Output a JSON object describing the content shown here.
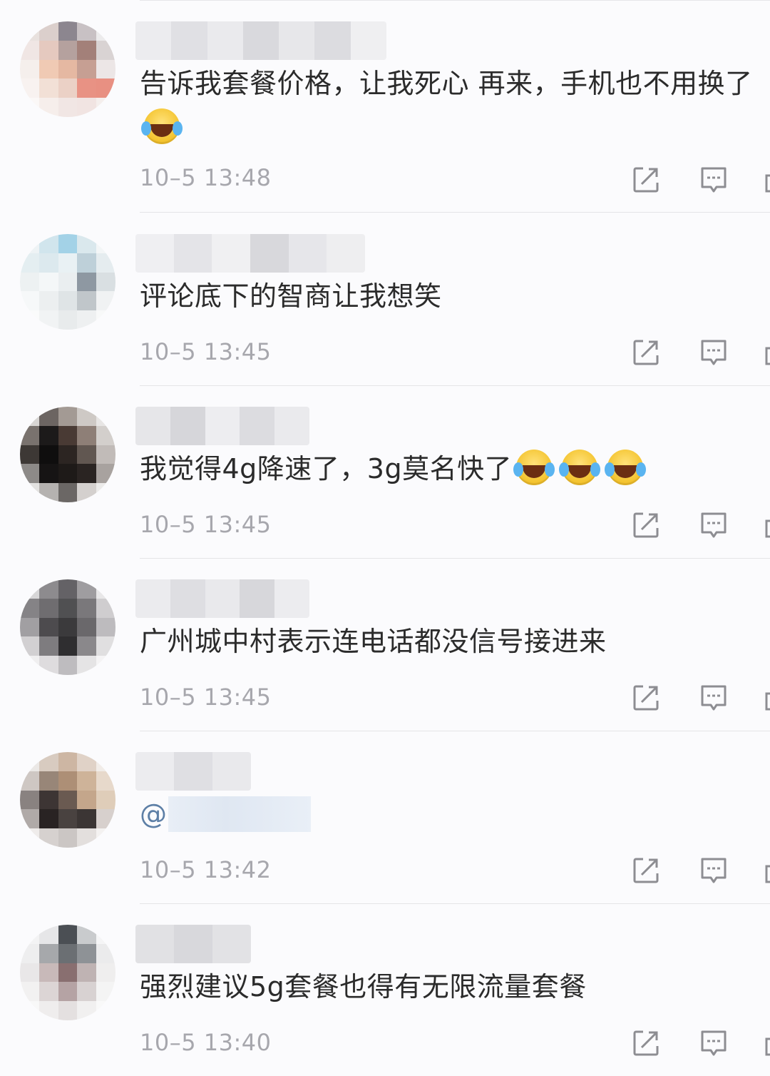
{
  "comments": [
    {
      "text": "告诉我套餐价格，让我死心 再来，手机也不用换了",
      "emoji_count": 1,
      "time": "10–5 13:48"
    },
    {
      "text": "评论底下的智商让我想笑",
      "emoji_count": 0,
      "time": "10–5 13:45"
    },
    {
      "text": "我觉得4g降速了，3g莫名快了",
      "emoji_count": 3,
      "time": "10–5 13:45"
    },
    {
      "text": "广州城中村表示连电话都没信号接进来",
      "emoji_count": 0,
      "time": "10–5 13:45"
    },
    {
      "text": "",
      "mention": "@",
      "emoji_count": 0,
      "time": "10–5 13:42"
    },
    {
      "text": "强烈建议5g套餐也得有无限流量套餐",
      "emoji_count": 0,
      "time": "10–5 13:40"
    }
  ],
  "icons": {
    "emoji": "laugh-cry-emoji",
    "share": "share-icon",
    "reply": "comment-icon",
    "like": "like-icon"
  },
  "colors": {
    "text": "#2b2b2b",
    "time": "#a7a7ad",
    "mention": "#5d7fa6",
    "divider": "#e4e4e7",
    "icon": "#8d8d92"
  }
}
